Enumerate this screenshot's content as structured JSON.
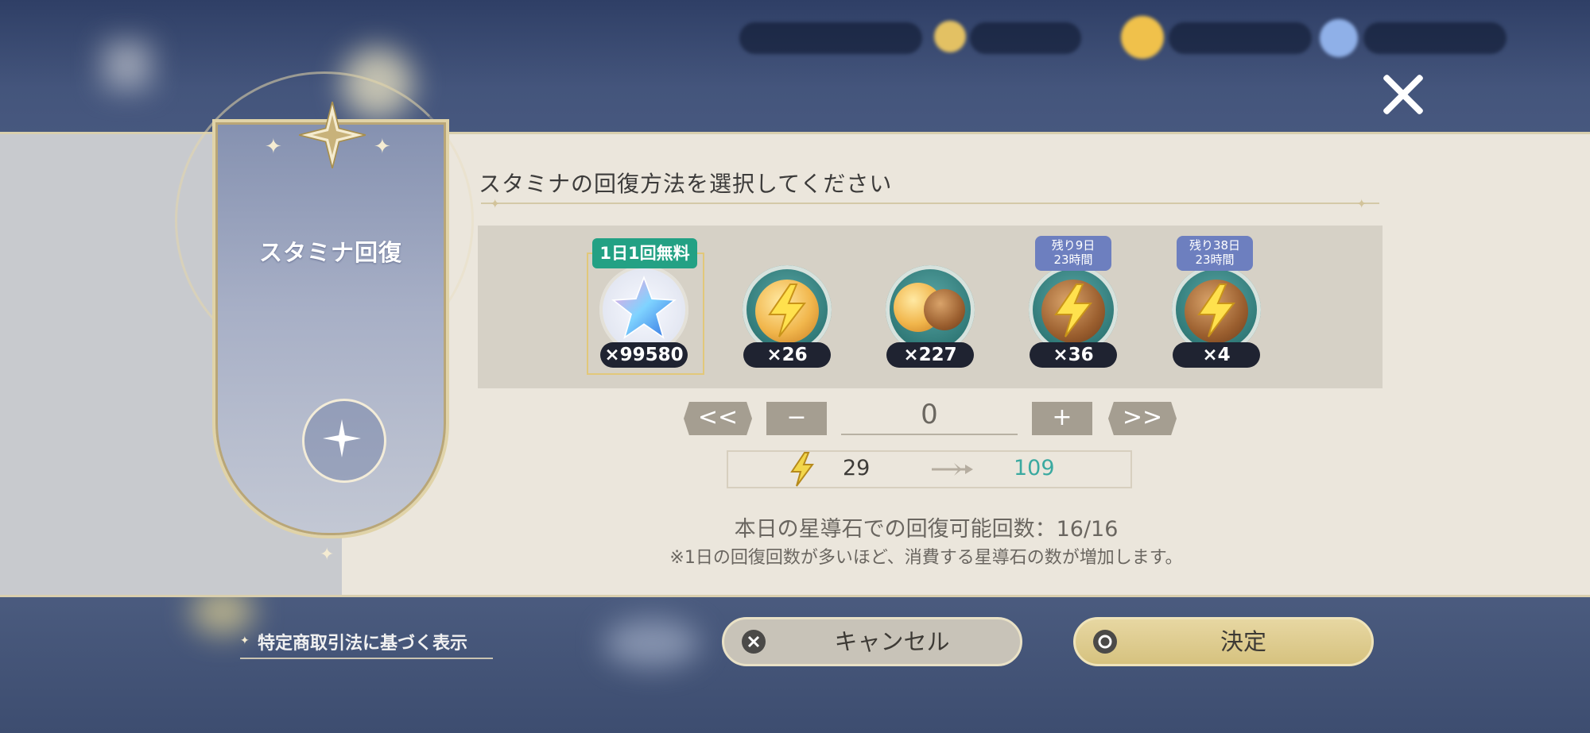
{
  "heading": "スタミナの回復方法を選択してください",
  "banner": {
    "title": "スタミナ回復"
  },
  "items": [
    {
      "count": "×99580",
      "badge": "1日1回無料",
      "icon": "star-crystal-icon"
    },
    {
      "count": "×26",
      "icon": "lightning-biscuit-icon"
    },
    {
      "count": "×227",
      "icon": "cookie-icon"
    },
    {
      "count": "×36",
      "timer_line1": "残り9日",
      "timer_line2": "23時間",
      "icon": "lightning-biscuit-icon"
    },
    {
      "count": "×4",
      "timer_line1": "残り38日",
      "timer_line2": "23時間",
      "icon": "lightning-biscuit-icon"
    }
  ],
  "stepper": {
    "min_label": "<<",
    "minus_label": "−",
    "value": "0",
    "plus_label": "+",
    "max_label": ">>"
  },
  "stamina": {
    "current": "29",
    "after": "109"
  },
  "info": {
    "recovery_count": "本日の星導石での回復可能回数：16/16",
    "note": "※1日の回復回数が多いほど、消費する星導石の数が増加します。"
  },
  "footer": {
    "legal_link": "特定商取引法に基づく表示"
  },
  "buttons": {
    "cancel": "キャンセル",
    "confirm": "決定"
  },
  "colors": {
    "accent_teal": "#3aa9a0",
    "free_badge": "#23a184",
    "timer_badge": "#6d7fbf"
  }
}
